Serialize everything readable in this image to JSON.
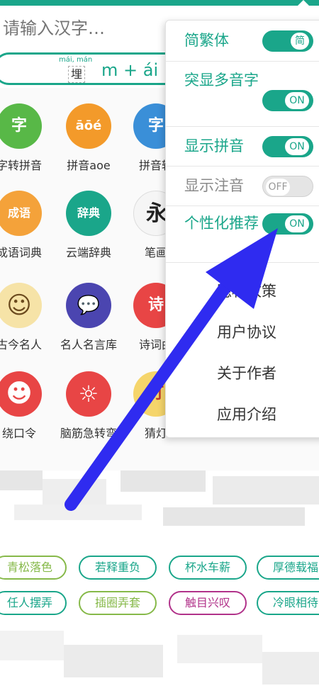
{
  "search": {
    "placeholder": "请输入汉字…"
  },
  "pinyin_demo": {
    "pinyin": "mái, mán",
    "char": "埋",
    "formula": "m + ái"
  },
  "apps": [
    {
      "label": "字转拼音",
      "color": "#58b847",
      "glyph": "字"
    },
    {
      "label": "拼音aoe",
      "color": "#f39a2a",
      "glyph": "āōé"
    },
    {
      "label": "拼音转",
      "color": "#3a8fd8",
      "glyph": "字"
    },
    {
      "label": "成语词典",
      "color": "#f4a23a",
      "glyph": "成语"
    },
    {
      "label": "云端辞典",
      "color": "#1aa68a",
      "glyph": "辞典"
    },
    {
      "label": "笔画",
      "color": "#f5f5f5",
      "glyph": "永"
    },
    {
      "label": "古今名人",
      "color": "#f6e3a7",
      "glyph": "☺"
    },
    {
      "label": "名人名言库",
      "color": "#4b45b0",
      "glyph": "💬"
    },
    {
      "label": "诗词曲",
      "color": "#e84545",
      "glyph": "诗"
    },
    {
      "label": "绕口令",
      "color": "#e84545",
      "glyph": "☻"
    },
    {
      "label": "脑筋急转弯",
      "color": "#e84545",
      "glyph": "☼"
    },
    {
      "label": "猜灯",
      "color": "#f5d56b",
      "glyph": "灯"
    }
  ],
  "idioms": [
    {
      "text": "青松落色",
      "color": "#86b949"
    },
    {
      "text": "若释重负",
      "color": "#1aa68a"
    },
    {
      "text": "杯水车薪",
      "color": "#1aa68a"
    },
    {
      "text": "厚德载福",
      "color": "#1aa68a"
    },
    {
      "text": "任人摆弄",
      "color": "#1aa68a"
    },
    {
      "text": "插圈弄套",
      "color": "#86b949"
    },
    {
      "text": "触目兴叹",
      "color": "#b1328a"
    },
    {
      "text": "冷眼相待",
      "color": "#1aa68a"
    }
  ],
  "menu": {
    "toggles": [
      {
        "label": "简繁体",
        "state": "简",
        "on": true
      },
      {
        "label": "突显多音字",
        "state": "ON",
        "on": true
      },
      {
        "label": "显示拼音",
        "state": "ON",
        "on": true
      },
      {
        "label": "显示注音",
        "state": "OFF",
        "on": false
      },
      {
        "label": "个性化推荐",
        "state": "ON",
        "on": true
      }
    ],
    "links": [
      "隐私政策",
      "用户协议",
      "关于作者",
      "应用介绍"
    ]
  },
  "colors": {
    "accent": "#1aa68a",
    "arrow": "#2f2bf0"
  }
}
